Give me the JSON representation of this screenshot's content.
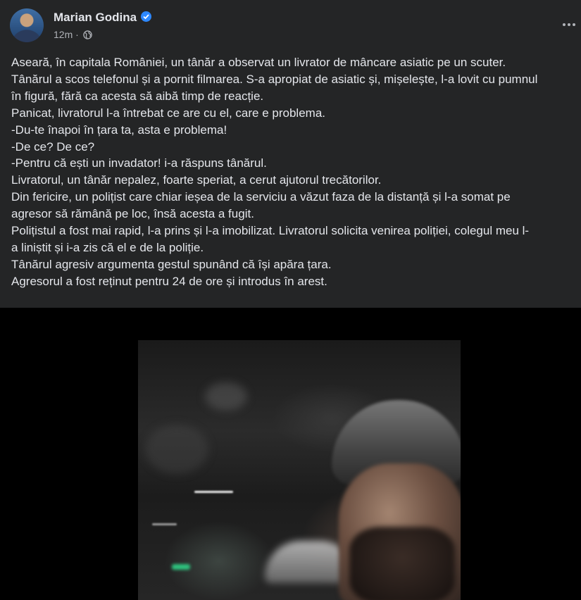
{
  "post": {
    "author": "Marian Godina",
    "verified": true,
    "timestamp": "12m",
    "separator": "·",
    "privacy_icon": "globe-icon",
    "more_icon": "more-options-icon",
    "lines": [
      "Aseară, în capitala României, un tânăr a observat un livrator de mâncare asiatic pe un scuter.",
      "Tânărul a scos telefonul și a pornit filmarea. S-a apropiat de asiatic și, mișelește, l-a lovit cu pumnul",
      "în figură, fără ca acesta să aibă timp de reacție.",
      "Panicat, livratorul l-a întrebat ce are cu el, care e problema.",
      "-Du-te înapoi în țara ta, asta e problema!",
      "-De ce? De ce?",
      "-Pentru că ești un invadator! i-a răspuns tânărul.",
      "Livratorul, un tânăr nepalez, foarte speriat, a cerut ajutorul trecătorilor.",
      "Din fericire, un polițist care chiar ieșea de la serviciu a văzut faza de la distanță și l-a somat pe",
      "agresor să rămână pe loc, însă acesta a fugit.",
      "Polițistul a fost mai rapid, l-a prins și l-a imobilizat. Livratorul solicita venirea poliției, colegul meu l-",
      "a liniștit și i-a zis că el e de la poliție.",
      "Tânărul agresiv argumenta gestul spunând că își apăra țara.",
      "Agresorul a fost reținut pentru 24 de ore și introdus în arest."
    ]
  },
  "colors": {
    "background": "#242526",
    "text": "#e4e6eb",
    "secondary_text": "#b0b3b8",
    "verified_badge": "#2d88ff",
    "video_background": "#000000"
  }
}
